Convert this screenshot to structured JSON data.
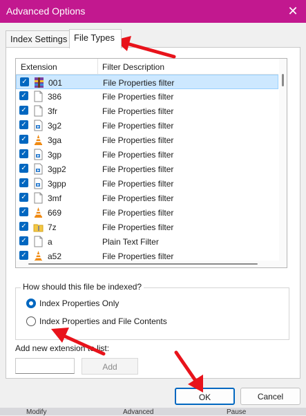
{
  "window": {
    "title": "Advanced Options",
    "close_glyph": "✕"
  },
  "tabs": [
    {
      "label": "Index Settings",
      "active": false
    },
    {
      "label": "File Types",
      "active": true
    }
  ],
  "list": {
    "columns": [
      "Extension",
      "Filter Description"
    ],
    "rows": [
      {
        "ext": "001",
        "desc": "File Properties filter",
        "icon": "archive-icon",
        "checked": true,
        "selected": true
      },
      {
        "ext": "386",
        "desc": "File Properties filter",
        "icon": "blank-file-icon",
        "checked": true
      },
      {
        "ext": "3fr",
        "desc": "File Properties filter",
        "icon": "blank-file-icon",
        "checked": true
      },
      {
        "ext": "3g2",
        "desc": "File Properties filter",
        "icon": "media-file-icon",
        "checked": true
      },
      {
        "ext": "3ga",
        "desc": "File Properties filter",
        "icon": "vlc-cone-icon",
        "checked": true
      },
      {
        "ext": "3gp",
        "desc": "File Properties filter",
        "icon": "media-file-icon",
        "checked": true
      },
      {
        "ext": "3gp2",
        "desc": "File Properties filter",
        "icon": "media-file-icon",
        "checked": true
      },
      {
        "ext": "3gpp",
        "desc": "File Properties filter",
        "icon": "media-file-icon",
        "checked": true
      },
      {
        "ext": "3mf",
        "desc": "File Properties filter",
        "icon": "blank-file-icon",
        "checked": true
      },
      {
        "ext": "669",
        "desc": "File Properties filter",
        "icon": "vlc-cone-icon",
        "checked": true
      },
      {
        "ext": "7z",
        "desc": "File Properties filter",
        "icon": "zip-folder-icon",
        "checked": true
      },
      {
        "ext": "a",
        "desc": "Plain Text Filter",
        "icon": "blank-file-icon",
        "checked": true
      },
      {
        "ext": "a52",
        "desc": "File Properties filter",
        "icon": "vlc-cone-icon",
        "checked": true
      }
    ]
  },
  "index_group": {
    "label": "How should this file be indexed?",
    "options": [
      {
        "label": "Index Properties Only",
        "selected": true
      },
      {
        "label": "Index Properties and File Contents",
        "selected": false
      }
    ]
  },
  "add_extension": {
    "label": "Add new extension to list:",
    "value": "",
    "button": "Add"
  },
  "footer": {
    "ok": "OK",
    "cancel": "Cancel"
  },
  "background_taskbar": [
    "Modify",
    "Advanced",
    "Pause"
  ],
  "colors": {
    "accent": "#c2188f",
    "checkbox": "#0067c0",
    "arrow": "#e8131b",
    "selection": "#cde8ff"
  }
}
